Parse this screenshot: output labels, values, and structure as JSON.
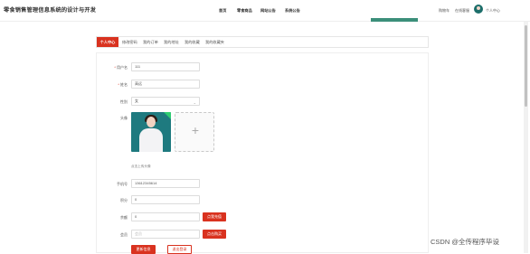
{
  "header": {
    "site_title": "零食销售管理信息系统的设计与开发",
    "nav": [
      "首页",
      "零食商品",
      "网站公告",
      "系统公告"
    ],
    "right_links": [
      "购物车",
      "在线客服",
      "个人中心"
    ]
  },
  "tabs": [
    {
      "label": "个人中心",
      "active": true
    },
    {
      "label": "修改密码",
      "active": false
    },
    {
      "label": "我的订单",
      "active": false
    },
    {
      "label": "我的地址",
      "active": false
    },
    {
      "label": "我的收藏",
      "active": false
    },
    {
      "label": "我的收藏夹",
      "active": false
    }
  ],
  "form": {
    "username_label": "用户名",
    "username_value": "111",
    "name_label": "姓名",
    "name_value": "高远",
    "gender_label": "性别",
    "gender_value": "女",
    "avatar_label": "头像",
    "avatar_tip": "点击上传头像",
    "phone_label": "手机号",
    "phone_value": "13612345614",
    "points_label": "积分",
    "points_value": "0",
    "balance_label": "余额",
    "balance_value": "0",
    "recharge_button": "点我充值",
    "member_label": "会员",
    "member_placeholder": "会员",
    "buy_member_button": "点击购买",
    "update_button": "更新信息",
    "logout_button": "退出登录"
  },
  "watermark": "CSDN @全传程序毕设",
  "colors": {
    "accent": "#d9321f",
    "avatar_bg": "#1e7a7f"
  }
}
